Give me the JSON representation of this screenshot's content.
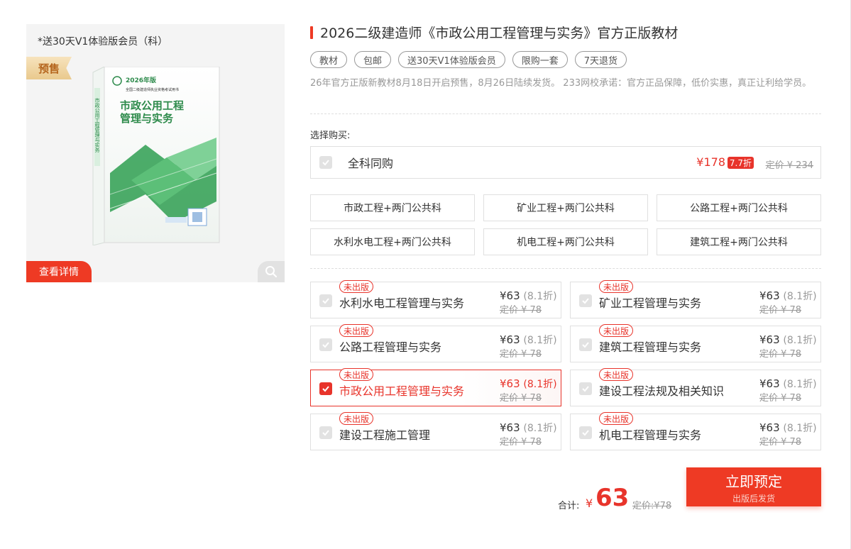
{
  "product": {
    "gift_note": "*送30天V1体验版会员（科）",
    "presale_badge": "预售",
    "view_detail": "查看详情",
    "book_cover": {
      "edition": "2026年版",
      "series": "全国二级建造师执业资格考试用书",
      "title_line1": "市政公用工程",
      "title_line2": "管理与实务",
      "spine_text": "市政公用工程管理与实务"
    }
  },
  "info": {
    "title": "2026二级建造师《市政公用工程管理与实务》官方正版教材",
    "tags": [
      "教材",
      "包邮",
      "送30天V1体验版会员",
      "限购一套",
      "7天退货"
    ],
    "description": "26年官方正版新教材8月18日开启预售，8月26日陆续发货。 233网校承诺：官方正品保障，低价实惠，真正让利给学员。",
    "choose_label": "选择购买:"
  },
  "full_set": {
    "label": "全科同购",
    "price": "¥178",
    "discount": "7.7折",
    "original": "定价 ¥ 234"
  },
  "combos": [
    "市政工程+两门公共科",
    "矿业工程+两门公共科",
    "公路工程+两门公共科",
    "水利水电工程+两门公共科",
    "机电工程+两门公共科",
    "建筑工程+两门公共科"
  ],
  "subjects": [
    {
      "badge": "未出版",
      "name": "水利水电工程管理与实务",
      "price": "¥63",
      "discount": "(8.1折)",
      "original": "定价 ¥ 78",
      "checked": false
    },
    {
      "badge": "未出版",
      "name": "矿业工程管理与实务",
      "price": "¥63",
      "discount": "(8.1折)",
      "original": "定价 ¥ 78",
      "checked": false
    },
    {
      "badge": "未出版",
      "name": "公路工程管理与实务",
      "price": "¥63",
      "discount": "(8.1折)",
      "original": "定价 ¥ 78",
      "checked": false
    },
    {
      "badge": "未出版",
      "name": "建筑工程管理与实务",
      "price": "¥63",
      "discount": "(8.1折)",
      "original": "定价 ¥ 78",
      "checked": false
    },
    {
      "badge": "未出版",
      "name": "市政公用工程管理与实务",
      "price": "¥63",
      "discount": "(8.1折)",
      "original": "定价 ¥ 78",
      "checked": true
    },
    {
      "badge": "未出版",
      "name": "建设工程法规及相关知识",
      "price": "¥63",
      "discount": "(8.1折)",
      "original": "定价 ¥ 78",
      "checked": false
    },
    {
      "badge": "未出版",
      "name": "建设工程施工管理",
      "price": "¥63",
      "discount": "(8.1折)",
      "original": "定价 ¥ 78",
      "checked": false
    },
    {
      "badge": "未出版",
      "name": "机电工程管理与实务",
      "price": "¥63",
      "discount": "(8.1折)",
      "original": "定价 ¥ 78",
      "checked": false
    }
  ],
  "summary": {
    "total_label": "合计:",
    "currency": "¥",
    "amount": "63",
    "original": "定价:¥78"
  },
  "order_button": {
    "label": "立即预定",
    "sub_label": "出版后发货"
  },
  "colors": {
    "accent": "#ee3a24",
    "price_red": "#e8342b",
    "book_green": "#3aa35a"
  }
}
